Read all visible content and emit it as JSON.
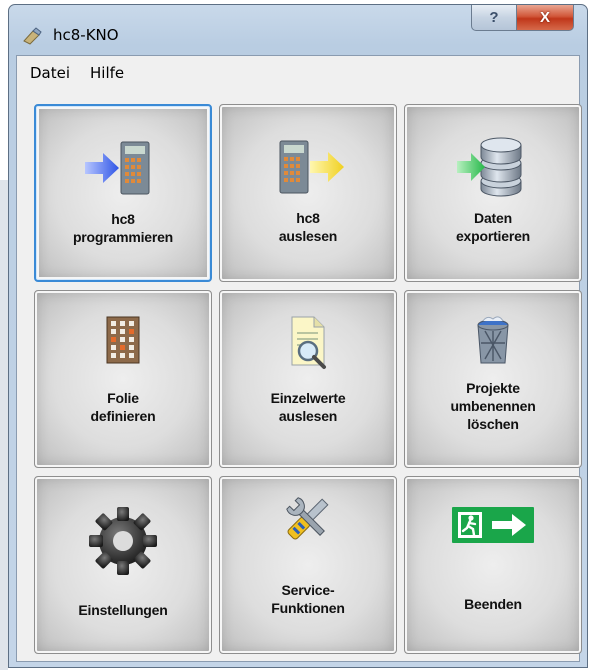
{
  "window": {
    "title": "hc8-KNO",
    "help_glyph": "?",
    "close_glyph": "X"
  },
  "menu": {
    "items": [
      "Datei",
      "Hilfe"
    ]
  },
  "tiles": [
    {
      "line1": "hc8",
      "line2": "programmieren",
      "icon": "device-import-icon"
    },
    {
      "line1": "hc8",
      "line2": "auslesen",
      "icon": "device-export-icon"
    },
    {
      "line1": "Daten",
      "line2": "exportieren",
      "icon": "database-export-icon"
    },
    {
      "line1": "Folie",
      "line2": "definieren",
      "icon": "grid-sheet-icon"
    },
    {
      "line1": "Einzelwerte",
      "line2": "auslesen",
      "icon": "document-search-icon"
    },
    {
      "line1": "Projekte",
      "line2": "umbenennen",
      "line3": "löschen",
      "icon": "trash-bin-icon"
    },
    {
      "line1": "Einstellungen",
      "icon": "gear-icon"
    },
    {
      "line1": "Service-",
      "line2": "Funktionen",
      "icon": "wrench-screwdriver-icon"
    },
    {
      "line1": "Beenden",
      "icon": "emergency-exit-icon"
    }
  ],
  "colors": {
    "selected_border": "#3a8ad6",
    "exit_green": "#1aa64a",
    "arrow_blue": "#2f55e6",
    "arrow_yellow": "#f0d020",
    "arrow_green": "#26b84a"
  }
}
